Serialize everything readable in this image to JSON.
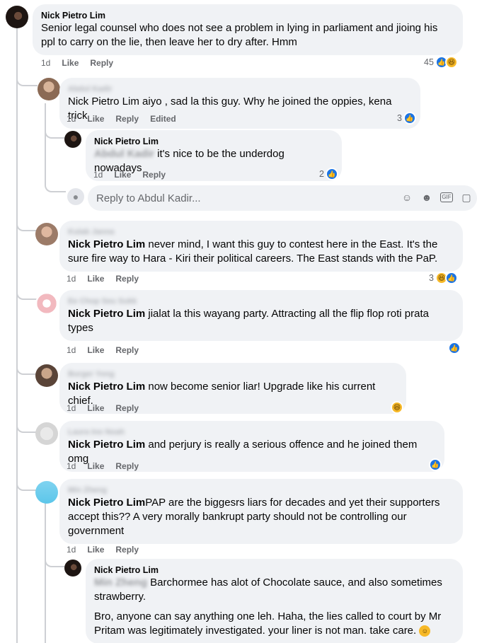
{
  "comments": [
    {
      "name": "Nick Pietro Lim",
      "text": "Senior legal counsel who does not see a problem in lying in parliament and jioing his ppl to carry on the lie, then leave her to dry after. Hmm",
      "time": "1d",
      "like": "Like",
      "reply": "Reply",
      "reactions": {
        "count": "45",
        "types": [
          "like-icon",
          "haha-icon"
        ]
      }
    },
    {
      "name": "Abdul Kadir",
      "mention": "Nick Pietro Lim",
      "text": " aiyo , sad la this guy. Why he joined the oppies, kena trick",
      "time": "1d",
      "like": "Like",
      "reply": "Reply",
      "edited": "Edited",
      "reactions": {
        "count": "3",
        "types": [
          "like-icon"
        ]
      }
    },
    {
      "name": "Nick Pietro Lim",
      "mention": "Abdul Kadir",
      "text": " it's nice to be the underdog nowadays",
      "time": "1d",
      "like": "Like",
      "reply": "Reply",
      "reactions": {
        "count": "2",
        "types": [
          "like-icon"
        ]
      }
    },
    {
      "name": "Kulab Janna",
      "mention": "Nick Pietro Lim",
      "text": " never mind, I want this guy to contest here in the East. It's the sure fire way to Hara - Kiri their political careers. The East stands with the PaP.",
      "time": "1d",
      "like": "Like",
      "reply": "Reply",
      "reactions": {
        "count": "3",
        "types": [
          "haha-icon",
          "like-icon"
        ]
      }
    },
    {
      "name": "Ee Chop Seu Sukk",
      "mention": "Nick Pietro Lim",
      "text": " jialat la this wayang party. Attracting all the flip flop roti prata types",
      "time": "1d",
      "like": "Like",
      "reply": "Reply",
      "reactions": {
        "count": "",
        "types": [
          "like-icon"
        ]
      }
    },
    {
      "name": "Burger Yong",
      "mention": "Nick Pietro Lim",
      "text": " now become senior liar! Upgrade like his current chief.",
      "time": "1d",
      "like": "Like",
      "reply": "Reply",
      "reactions": {
        "count": "",
        "types": [
          "haha-icon"
        ]
      }
    },
    {
      "name": "Laura Ino Noah",
      "mention": "Nick Pietro Lim",
      "text": " and perjury is really a serious offence and he joined them omg",
      "time": "1d",
      "like": "Like",
      "reply": "Reply",
      "reactions": {
        "count": "",
        "types": [
          "like-icon"
        ]
      }
    },
    {
      "name": "Min Zheng",
      "mention": "Nick Pietro Lim",
      "text": "PAP are the biggesrs liars for decades and yet their supporters accept this?? A very morally bankrupt party should not be controlling our government",
      "time": "1d",
      "like": "Like",
      "reply": "Reply"
    },
    {
      "name": "Nick Pietro Lim",
      "mention": "Min Zheng",
      "text": " Barchormee has alot of Chocolate sauce, and also sometimes strawberry.",
      "text2": "Bro, anyone can say anything one leh. Haha, the lies called to court by Mr Pritam was legitimately investigated. your liner is not man. take care."
    }
  ],
  "reply_box": {
    "placeholder": "Reply to Abdul Kadir..."
  },
  "colors": {
    "like": "#1b74e4",
    "haha": "#f7b928",
    "bubble": "#f0f2f5",
    "meta": "#65676b"
  }
}
